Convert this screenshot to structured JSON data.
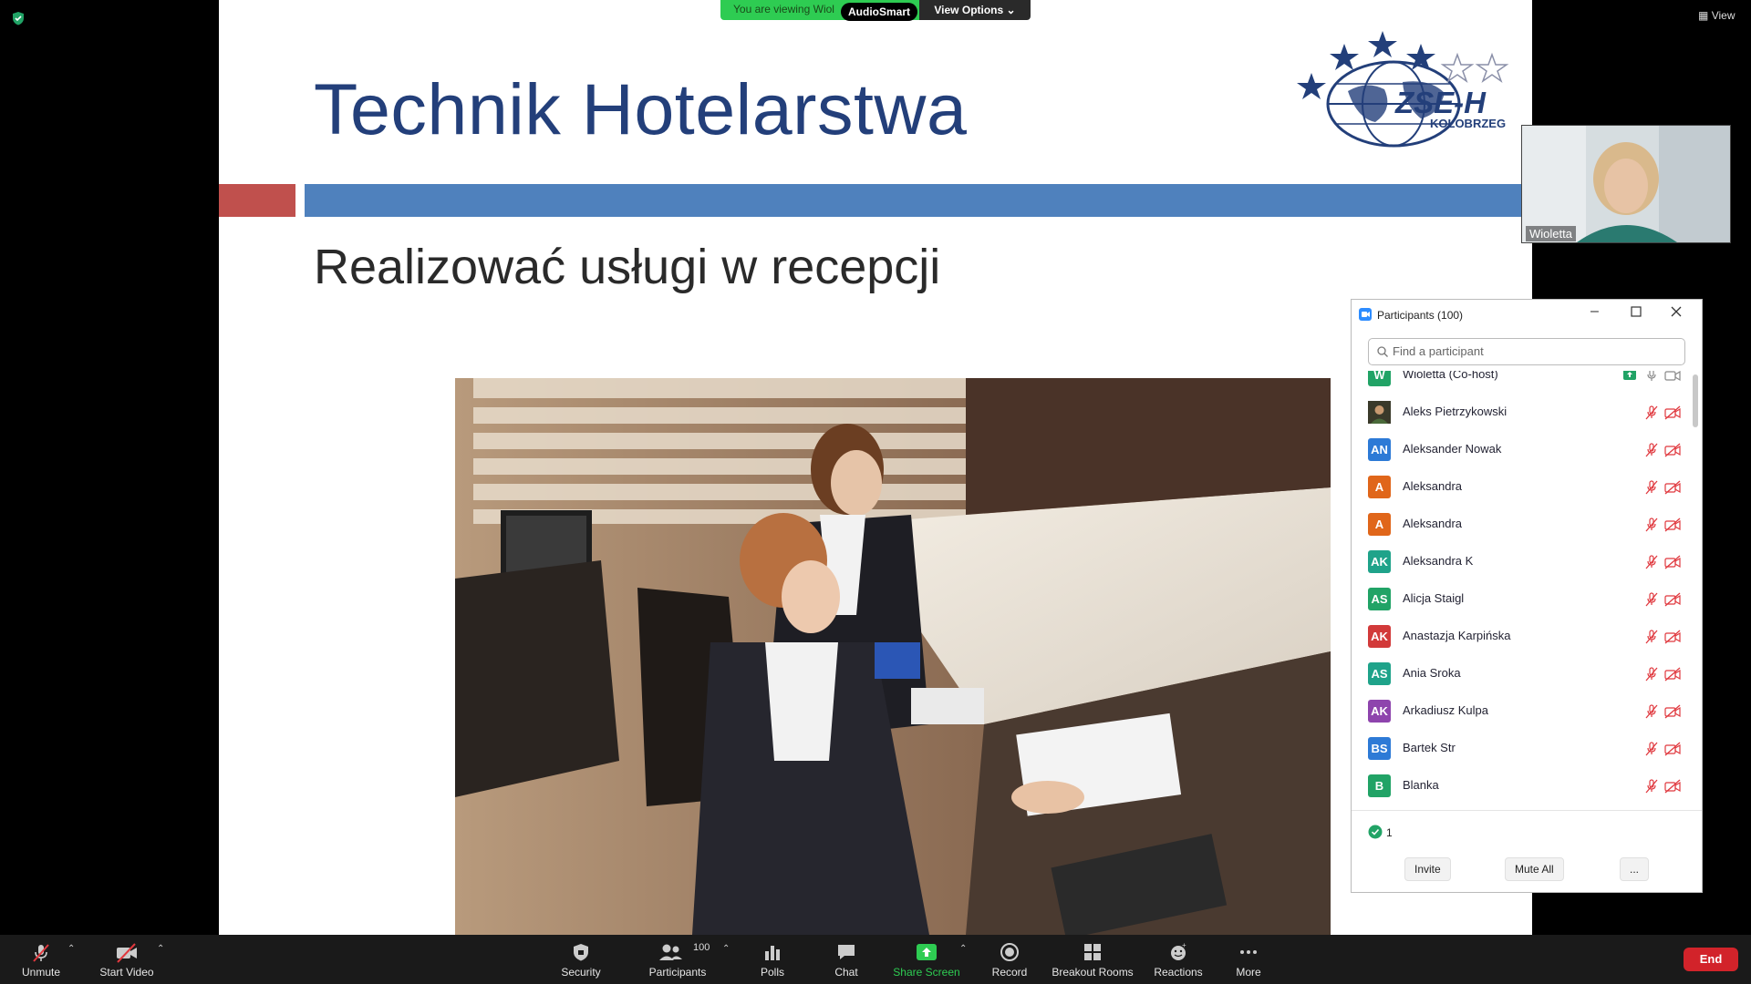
{
  "banner": {
    "viewing_text": "You are viewing Wiol",
    "pill_label": "AudioSmart",
    "view_options_label": "View Options"
  },
  "top_right": {
    "view_label": "View"
  },
  "slide": {
    "title": "Technik Hotelarstwa",
    "subtitle": "Realizować usługi w recepcji",
    "logo_text": "ZSE-H",
    "logo_subtext": "KOŁOBRZEG"
  },
  "speaker": {
    "name": "Wioletta"
  },
  "participants_panel": {
    "title": "Participants (100)",
    "search_placeholder": "Find a participant",
    "participants": [
      {
        "initials": "W",
        "name": "Wioletta (Co-host)",
        "color": "#21a366",
        "muted": false
      },
      {
        "initials": "",
        "name": "Aleks Pietrzykowski",
        "color": "#3a3a2a",
        "muted": true
      },
      {
        "initials": "AN",
        "name": "Aleksander Nowak",
        "color": "#2d7ad6",
        "muted": true
      },
      {
        "initials": "A",
        "name": "Aleksandra",
        "color": "#e0661a",
        "muted": true
      },
      {
        "initials": "A",
        "name": "Aleksandra",
        "color": "#e0661a",
        "muted": true
      },
      {
        "initials": "AK",
        "name": "Aleksandra K",
        "color": "#1fa38a",
        "muted": true
      },
      {
        "initials": "AS",
        "name": "Alicja Staigl",
        "color": "#21a366",
        "muted": true
      },
      {
        "initials": "AK",
        "name": "Anastazja Karpińska",
        "color": "#d23a3a",
        "muted": true
      },
      {
        "initials": "AS",
        "name": "Ania Sroka",
        "color": "#1fa38a",
        "muted": true
      },
      {
        "initials": "AK",
        "name": "Arkadiusz Kulpa",
        "color": "#8e44ad",
        "muted": true
      },
      {
        "initials": "BS",
        "name": "Bartek Str",
        "color": "#2d7ad6",
        "muted": true
      },
      {
        "initials": "B",
        "name": "Blanka",
        "color": "#21a366",
        "muted": true
      }
    ],
    "nonverbal_count": "1",
    "invite_label": "Invite",
    "mute_all_label": "Mute All",
    "more_label": "..."
  },
  "toolbar": {
    "unmute": "Unmute",
    "start_video": "Start Video",
    "security": "Security",
    "participants": "Participants",
    "participants_count": "100",
    "polls": "Polls",
    "chat": "Chat",
    "share_screen": "Share Screen",
    "record": "Record",
    "breakout_rooms": "Breakout Rooms",
    "reactions": "Reactions",
    "more": "More",
    "end": "End"
  },
  "colors": {
    "title_blue": "#233f7a",
    "bar_red": "#c0504d",
    "bar_blue": "#4f81bd",
    "share_green": "#2ecc52",
    "end_red": "#d2232a"
  }
}
